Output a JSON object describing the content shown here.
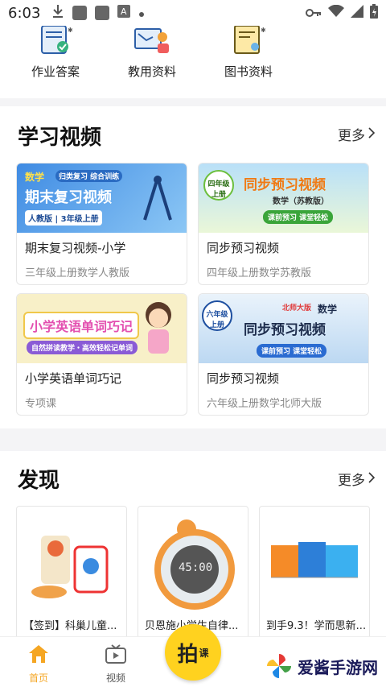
{
  "status_bar": {
    "time": "6:03"
  },
  "quick_links": [
    {
      "label": "作业答案",
      "icon": "homework-answer-icon"
    },
    {
      "label": "教用资料",
      "icon": "teaching-material-icon"
    },
    {
      "label": "图书资料",
      "icon": "book-material-icon"
    }
  ],
  "study_videos": {
    "title": "学习视频",
    "more": "更多",
    "items": [
      {
        "title": "期末复习视频-小学",
        "subtitle": "三年级上册数学人教版",
        "thumb": {
          "tag": "数学",
          "pill": "归类复习 综合训练",
          "headline": "期末复习视频",
          "meta": "人教版 | 3年级上册"
        }
      },
      {
        "title": "同步预习视频",
        "subtitle": "四年级上册数学苏教版",
        "thumb": {
          "grade": "四年级上册",
          "headline": "同步预习视频",
          "sub": "数学（苏教版）",
          "pill": "课前预习 课堂轻松"
        }
      },
      {
        "title": "小学英语单词巧记",
        "subtitle": "专项课",
        "thumb": {
          "headline": "小学英语单词巧记",
          "pill": "自然拼读教学・高效轻松记单词"
        }
      },
      {
        "title": "同步预习视频",
        "subtitle": "六年级上册数学北师大版",
        "thumb": {
          "grade": "六年级上册",
          "tag": "北师大版",
          "subject": "数学",
          "headline": "同步预习视频",
          "pill": "课前预习 课堂轻松"
        }
      }
    ]
  },
  "discover": {
    "title": "发现",
    "more": "更多",
    "items": [
      {
        "title": "【签到】科巢儿童..."
      },
      {
        "title": "贝恩施小学生自律..."
      },
      {
        "title": "到手9.3！学而思新..."
      }
    ],
    "timer_display": "45:00"
  },
  "tabs": [
    {
      "label": "首页",
      "icon": "home-icon",
      "active": true
    },
    {
      "label": "视频",
      "icon": "video-icon",
      "active": false
    }
  ],
  "fab": {
    "label": "拍",
    "badge": "课"
  },
  "watermark": {
    "text": "爱酱手游网"
  },
  "colors": {
    "accent": "#f5a623",
    "fab": "#ffd21f"
  }
}
